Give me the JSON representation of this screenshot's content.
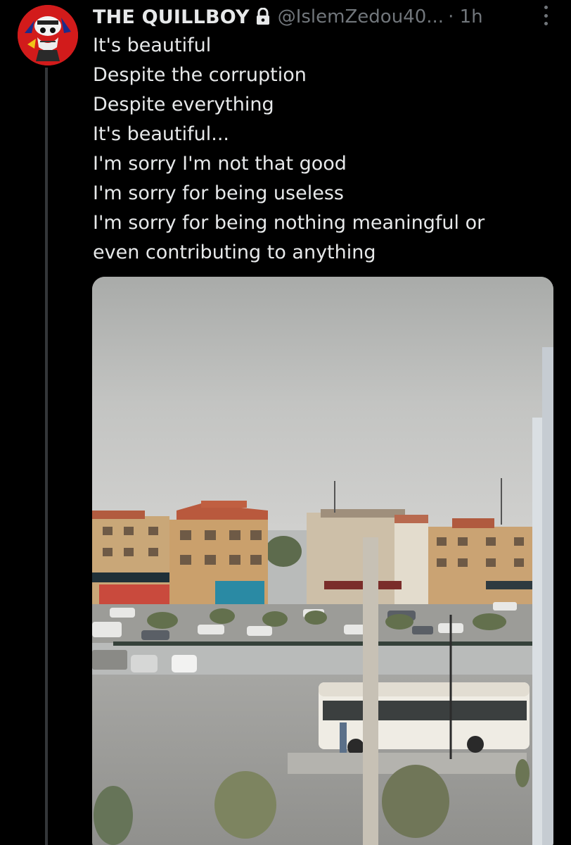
{
  "tweet": {
    "display_name": "THE QUILLBOY",
    "handle": "@IslemZedou40...",
    "time": "· 1h",
    "text_lines": [
      "It's beautiful",
      "Despite the corruption",
      "Despite everything",
      "It's beautiful...",
      "I'm sorry I'm not that good",
      "I'm sorry for being useless",
      "I'm sorry for being nothing meaningful or",
      "even contributing to anything"
    ]
  },
  "icons": {
    "lock": "lock-icon",
    "more": "more-options-icon",
    "avatar": "avatar-image"
  },
  "colors": {
    "background": "#000000",
    "text": "#e7e9ea",
    "secondary": "#71767b",
    "thread_line": "#333639"
  }
}
